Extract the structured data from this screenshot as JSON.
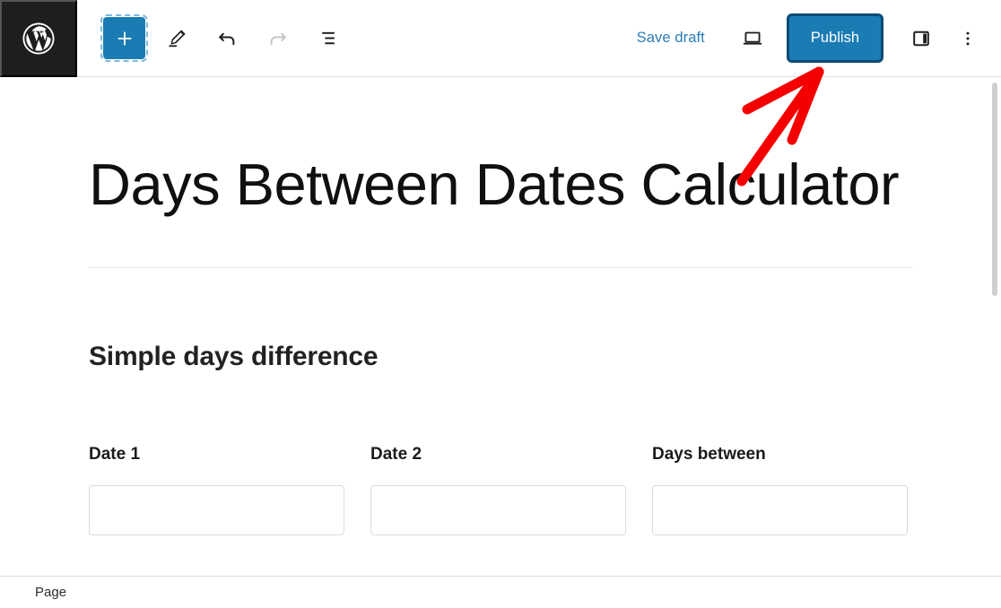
{
  "toolbar": {
    "logo_icon": "wordpress-logo-icon",
    "add_block_label": "+",
    "add_block_name": "add-block-icon",
    "edit_tool_name": "pencil-edit-icon",
    "undo_name": "undo-arrow-icon",
    "redo_name": "redo-arrow-icon",
    "list_view_name": "document-overview-icon",
    "save_draft_label": "Save draft",
    "preview_name": "desktop-preview-icon",
    "publish_label": "Publish",
    "sidebar_toggle_name": "settings-sidebar-icon",
    "options_name": "more-options-ellipsis-icon"
  },
  "editor": {
    "post_title": "Days Between Dates Calculator",
    "section_heading": "Simple days difference",
    "fields": [
      {
        "label": "Date 1",
        "value": "",
        "placeholder": ""
      },
      {
        "label": "Date 2",
        "value": "",
        "placeholder": ""
      },
      {
        "label": "Days between",
        "value": "",
        "placeholder": ""
      }
    ]
  },
  "bottom_bar": {
    "breadcrumb": "Page"
  },
  "annotation": {
    "arrow_color": "#f50000",
    "points_to": "Publish"
  },
  "colors": {
    "accent_blue": "#1b7cb4",
    "link_blue": "#2b7cb8",
    "focus_ring": "#0a4a75",
    "chrome_dark": "#1e1e1e",
    "border_light": "#e0e0e0"
  }
}
